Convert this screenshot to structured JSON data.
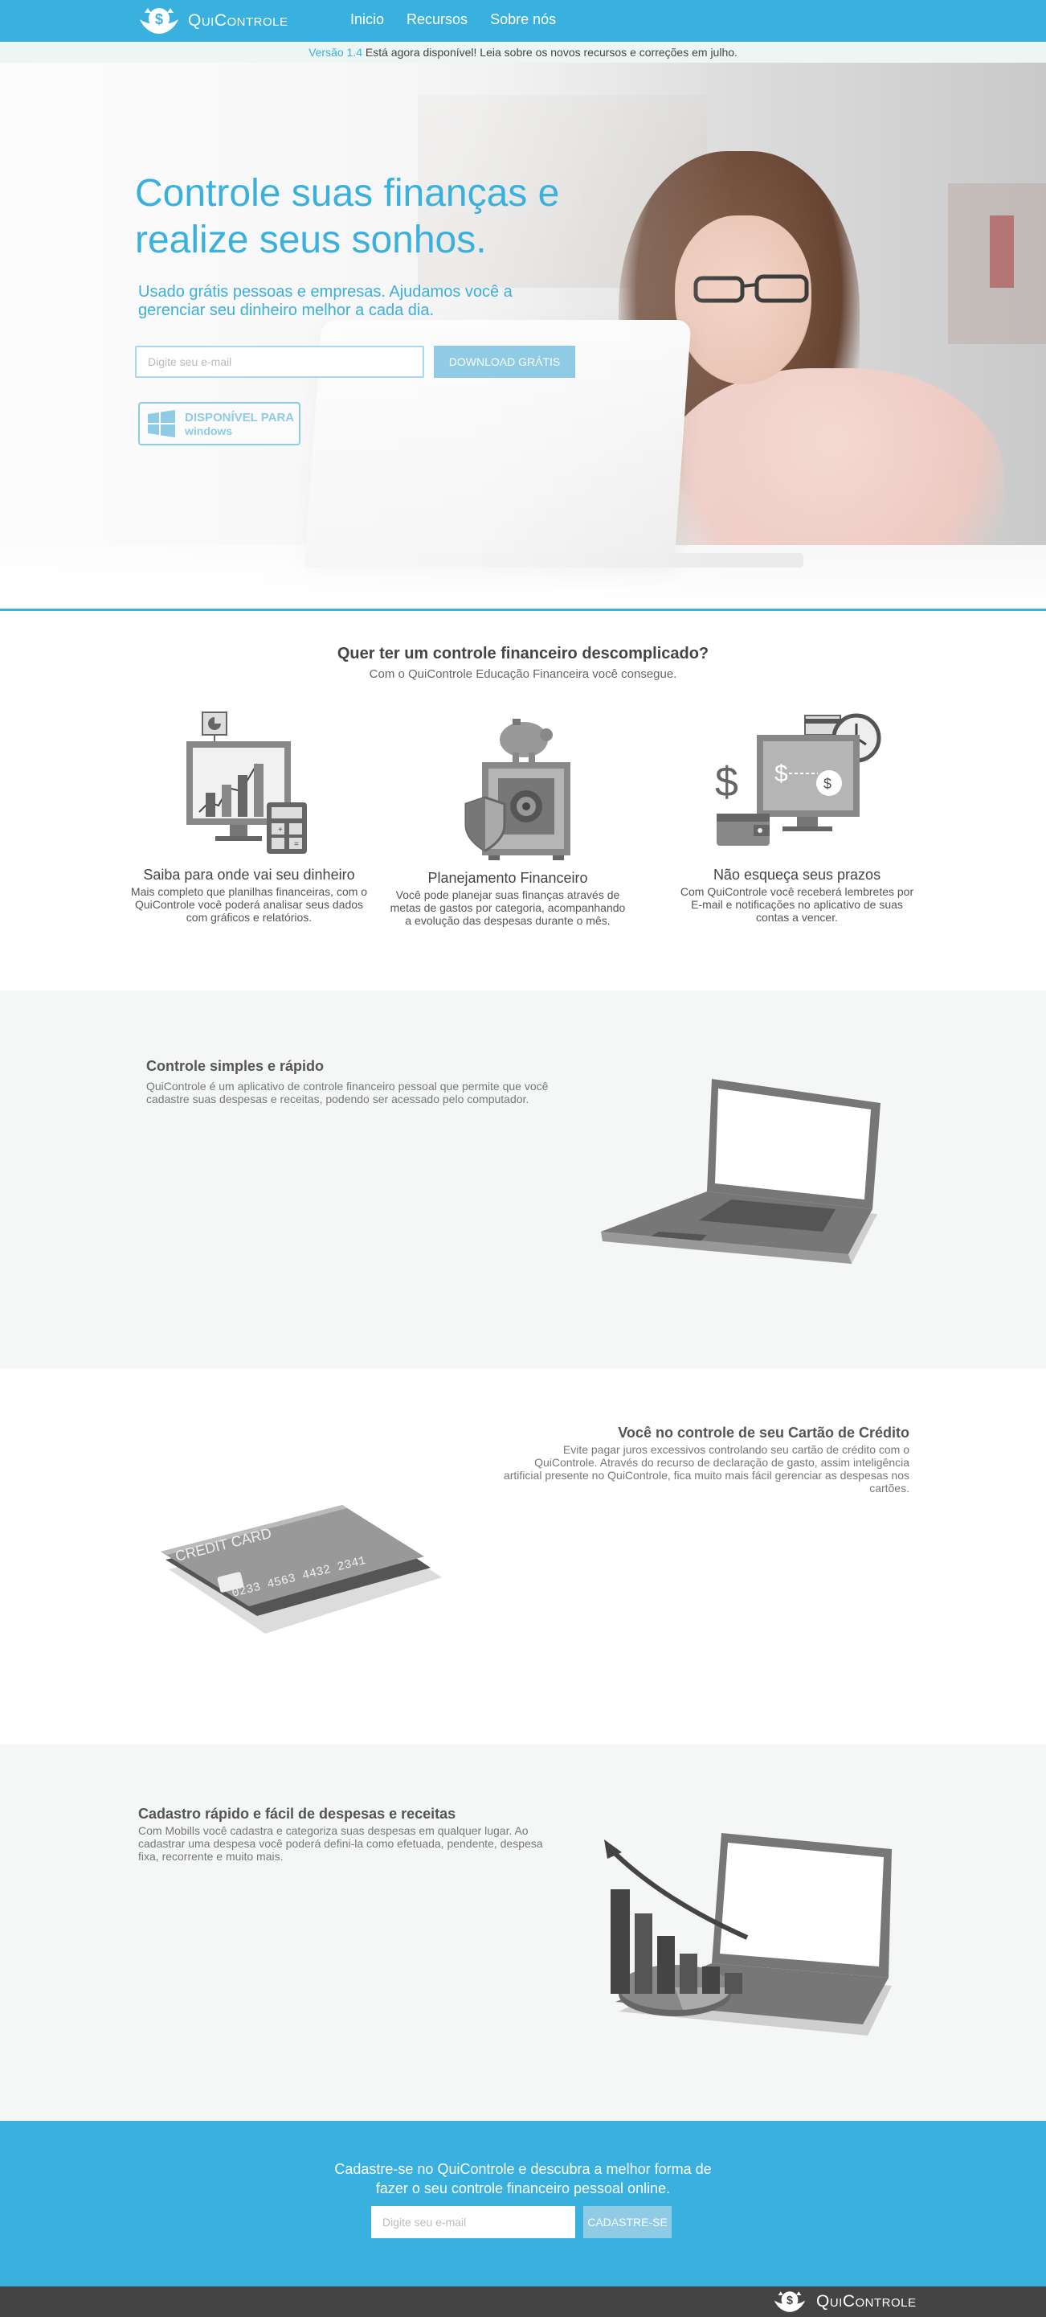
{
  "nav": {
    "brand_first": "Q",
    "brand_rest_1": "UI",
    "brand_second": "C",
    "brand_rest_2": "ONTROLE",
    "links": [
      "Inicio",
      "Recursos",
      "Sobre nós"
    ]
  },
  "announcement": {
    "version": "Versão 1.4",
    "text": " Está agora disponível! Leia sobre os novos recursos e correções em julho."
  },
  "hero": {
    "title": "Controle suas finanças e realize seus sonhos.",
    "subtitle": "Usado grátis pessoas e empresas. Ajudamos você a gerenciar seu dinheiro melhor a cada dia.",
    "email_placeholder": "Digite seu e-mail",
    "download_button": "DOWNLOAD GRÁTIS",
    "badge_line1": "DISPONÍVEL PARA",
    "badge_line2": "windows"
  },
  "features": {
    "title": "Quer ter um controle financeiro descomplicado?",
    "subtitle": "Com o QuiControle Educação Financeira você consegue.",
    "items": [
      {
        "title": "Saiba para onde vai seu dinheiro",
        "desc": "Mais completo que planilhas financeiras, com o QuiControle você poderá analisar seus dados com gráficos e relatórios."
      },
      {
        "title": "Planejamento Financeiro",
        "desc": "Você pode planejar suas finanças através de metas de gastos por categoria, acompanhando a evolução das despesas durante o mês."
      },
      {
        "title": "Não esqueça seus prazos",
        "desc": "Com QuiControle você receberá lembretes por E-mail e notificações no aplicativo de suas contas a vencer."
      }
    ]
  },
  "sections": [
    {
      "title": "Controle simples e rápido",
      "desc": "QuiControle é um aplicativo de controle financeiro pessoal que permite que você cadastre suas despesas e receitas, podendo ser acessado pelo computador."
    },
    {
      "title": "Você no controle de seu Cartão de Crédito",
      "desc": "Evite pagar juros excessivos controlando seu cartão de crédito com o QuiControle. Através do recurso de declaração de gasto, assim inteligência artificial presente no QuiControle, fica muito mais fácil gerenciar as despesas nos cartões.",
      "card_label": "CREDIT CARD",
      "card_number": "0233 4563 4432 2341"
    },
    {
      "title": "Cadastro rápido e fácil de despesas e receitas",
      "desc": "Com Mobills você cadastra e categoriza suas despesas em qualquer lugar. Ao cadastrar uma despesa você poderá defini-la como efetuada, pendente, despesa fixa, recorrente e muito mais."
    }
  ],
  "cta": {
    "text": "Cadastre-se no QuiControle e descubra a melhor forma de fazer o seu controle financeiro pessoal online.",
    "email_placeholder": "Digite seu e-mail",
    "button": "CADASTRE-SE"
  },
  "colors": {
    "accent": "#3ab0de",
    "accent_light": "#8fcbe4",
    "section_gray": "#f4f7f6",
    "footer": "#444444"
  },
  "icons": [
    "brand-logo-icon",
    "windows-icon",
    "monitor-chart-icon",
    "safe-piggy-icon",
    "calendar-money-icon",
    "laptop-icon",
    "credit-card-icon",
    "chart-laptop-icon"
  ]
}
